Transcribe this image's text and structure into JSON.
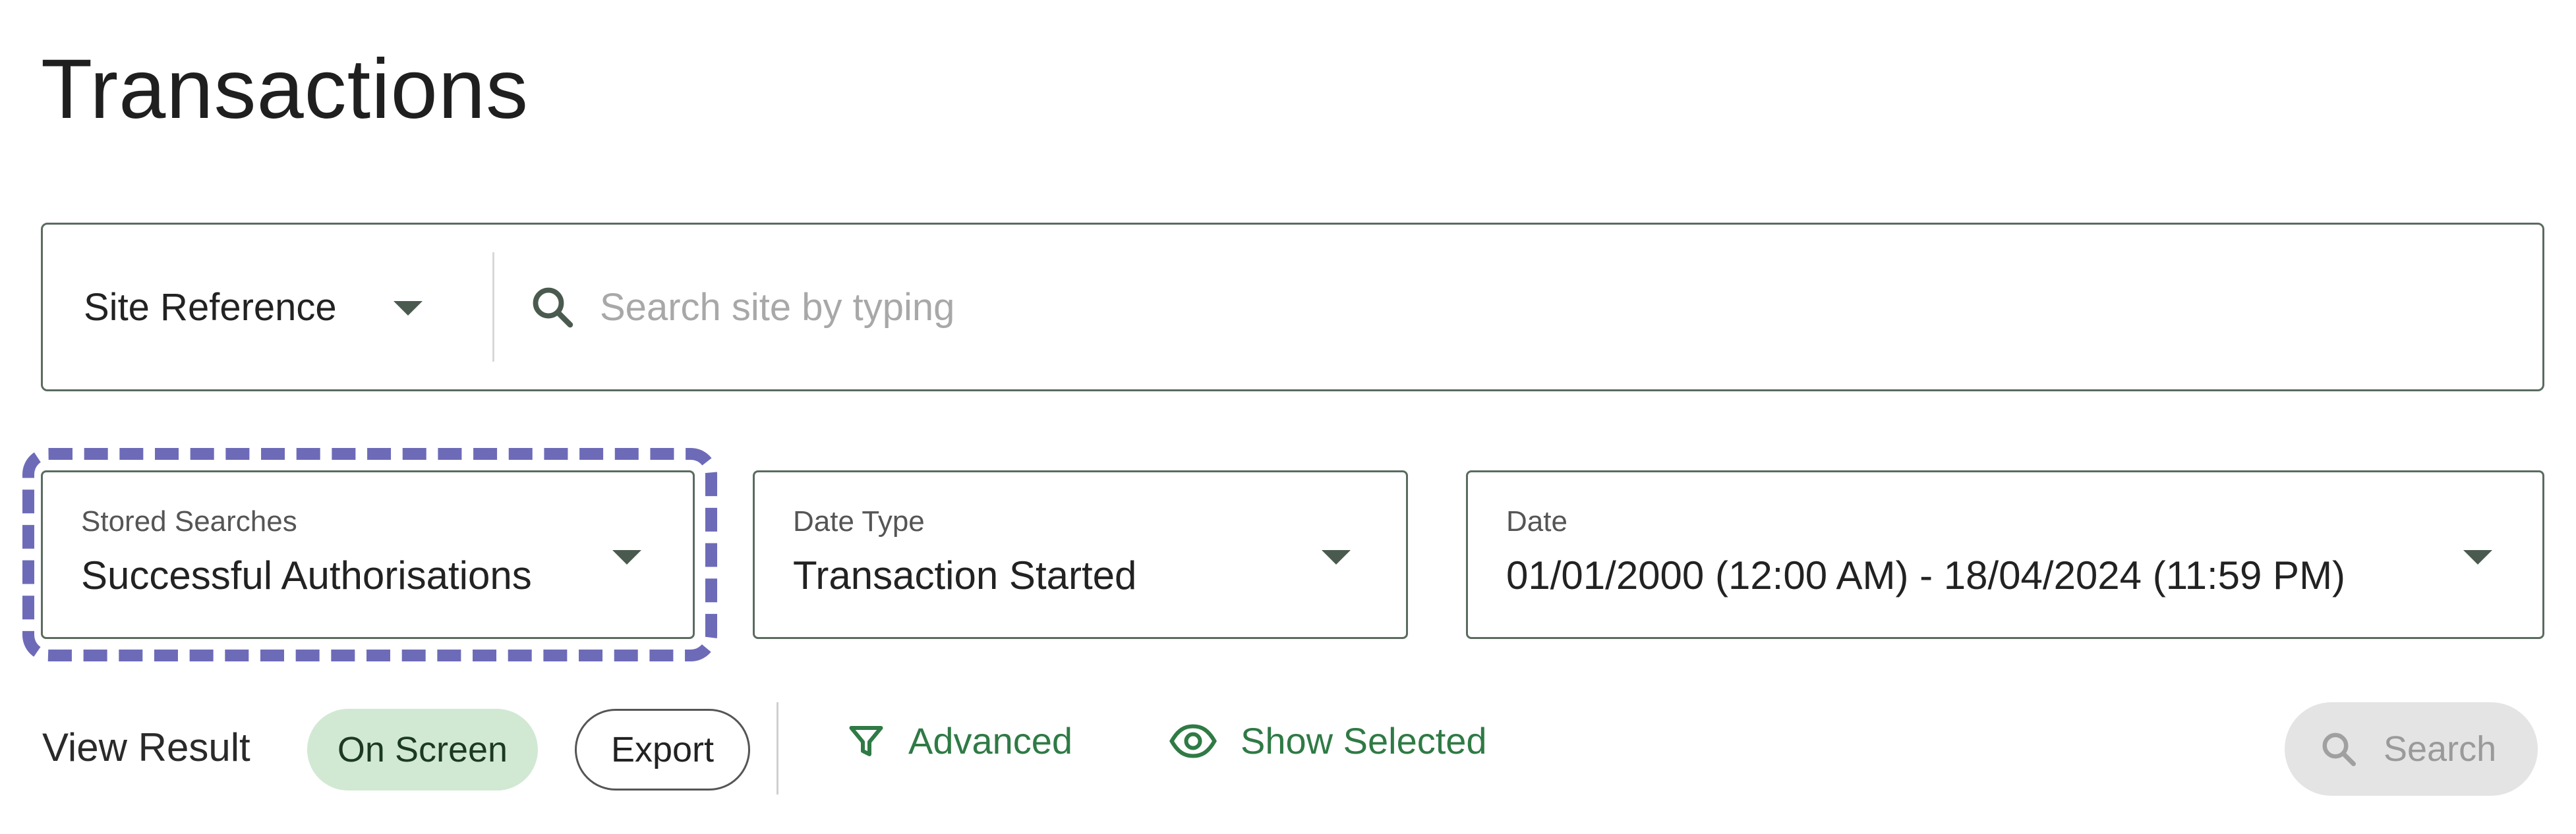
{
  "page": {
    "title": "Transactions"
  },
  "search": {
    "field_selector_label": "Site Reference",
    "placeholder": "Search site by typing",
    "value": ""
  },
  "filters": {
    "stored_searches": {
      "label": "Stored Searches",
      "value": "Successful Authorisations"
    },
    "date_type": {
      "label": "Date Type",
      "value": "Transaction Started"
    },
    "date": {
      "label": "Date",
      "value": "01/01/2000 (12:00 AM) - 18/04/2024 (11:59 PM)"
    }
  },
  "view_result": {
    "label": "View Result",
    "options": [
      {
        "label": "On Screen",
        "selected": true
      },
      {
        "label": "Export",
        "selected": false
      }
    ]
  },
  "actions": {
    "advanced_label": "Advanced",
    "show_selected_label": "Show Selected",
    "search_label": "Search"
  },
  "icons": {
    "search": "search-icon",
    "dropdown": "caret-down-icon",
    "filter": "filter-icon",
    "eye": "eye-icon"
  },
  "colors": {
    "accent_green": "#2f7a45",
    "selected_pill": "#d1e9d3",
    "highlight_dashed": "#6d6bb8",
    "border": "#5a6b5f",
    "disabled_bg": "#e4e4e4"
  }
}
